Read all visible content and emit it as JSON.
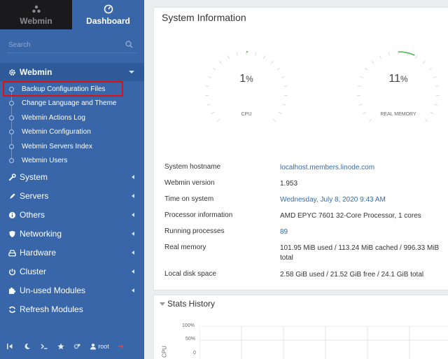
{
  "tabs": {
    "webmin": "Webmin",
    "dashboard": "Dashboard"
  },
  "search": {
    "placeholder": "Search"
  },
  "sidebar": {
    "open_section": "Webmin",
    "submenu": [
      "Backup Configuration Files",
      "Change Language and Theme",
      "Webmin Actions Log",
      "Webmin Configuration",
      "Webmin Servers Index",
      "Webmin Users"
    ],
    "sections": [
      "System",
      "Servers",
      "Others",
      "Networking",
      "Hardware",
      "Cluster",
      "Un-used Modules",
      "Refresh Modules"
    ]
  },
  "bottom_bar": {
    "user": "root"
  },
  "system_info": {
    "title": "System Information",
    "cpu": {
      "value": "1",
      "unit": "%",
      "label": "CPU",
      "percent": 1
    },
    "memory": {
      "value": "11",
      "unit": "%",
      "label": "REAL MEMORY",
      "percent": 11
    },
    "rows": [
      {
        "key": "System hostname",
        "value": "localhost.members.linode.com"
      },
      {
        "key": "Webmin version",
        "value": "1.953"
      },
      {
        "key": "Time on system",
        "value": "Wednesday, July 8, 2020 9:43 AM"
      },
      {
        "key": "Processor information",
        "value": "AMD EPYC 7601 32-Core Processor, 1 cores"
      },
      {
        "key": "Running processes",
        "value": "89"
      },
      {
        "key": "Real memory",
        "value": "101.95 MiB used / 113.24 MiB cached / 996.33 MiB total"
      },
      {
        "key": "Local disk space",
        "value": "2.58 GiB used / 21.52 GiB free / 24.1 GiB total"
      }
    ]
  },
  "stats_history": {
    "title": "Stats History",
    "chart_label": "CPU",
    "y_ticks": [
      "100%",
      "50%",
      "0"
    ]
  },
  "colors": {
    "sidebar": "#3866a8",
    "accent_green": "#4caf50",
    "link": "#2d6db5",
    "highlight": "#e01010"
  }
}
